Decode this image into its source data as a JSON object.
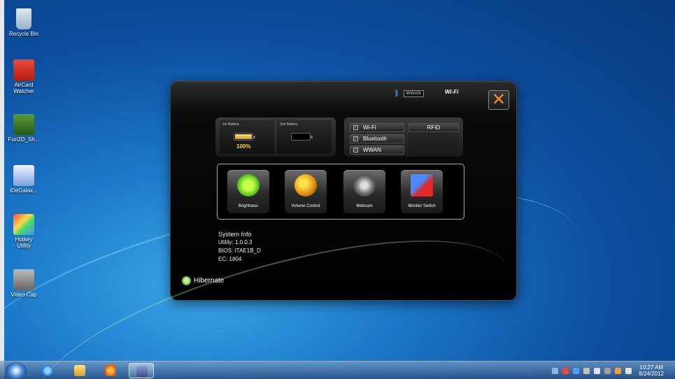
{
  "desktop": {
    "icons": [
      {
        "label": "Recycle Bin"
      },
      {
        "label": "AirCard\nWatcher"
      },
      {
        "label": "Fun2D_Sh..."
      },
      {
        "label": "iDeGalax..."
      },
      {
        "label": "Hotkey\nUtility"
      },
      {
        "label": "Video Cap"
      }
    ]
  },
  "window": {
    "wwan_badge": "WWAN",
    "wifi_badge": "Wi-Fi",
    "close_glyph": "✕"
  },
  "battery": {
    "first_label": "1st Battery",
    "second_label": "2nd Battery",
    "first_percent": "100%",
    "first_level": 1.0,
    "second_level": 0.0
  },
  "wireless": {
    "wifi_label": "Wi-Fi",
    "bluetooth_label": "Bluetooth",
    "wwan_label": "WWAN",
    "rfid_label": "RFID"
  },
  "functions": {
    "brightness": "Brightness",
    "volume": "Volume Control",
    "webcam": "Webcam",
    "monitor": "Monitor Switch"
  },
  "system_info": {
    "heading": "System Info",
    "utility": "Utility: 1.0.0.3",
    "bios": "BIOS: ITAE1B_D",
    "ec": "EC: 1804"
  },
  "hibernate_label": "Hibernate",
  "taskbar": {
    "clock_time": "10:27 AM",
    "clock_date": "8/24/2012"
  }
}
